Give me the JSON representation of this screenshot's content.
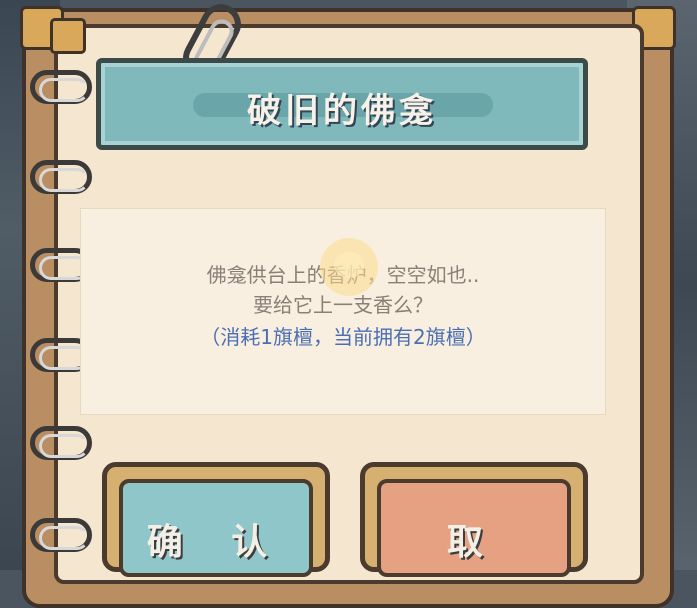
{
  "dialog": {
    "title": "破旧的佛龛",
    "message_line1": "佛龛供台上的香炉，空空如也..",
    "message_line2": "要给它上一支香么？",
    "cost_note": "（消耗1旗檀，当前拥有2旗檀）"
  },
  "buttons": {
    "confirm_label": "确 认",
    "cancel_label": "取"
  },
  "colors": {
    "title_banner": "#7fb9bc",
    "confirm_button": "#8ec6c9",
    "cancel_button": "#e6a182",
    "page": "#f4e6cf",
    "note_text": "#4a6fb3"
  },
  "icons": [
    "paperclip-icon",
    "binder-ring-icon"
  ]
}
